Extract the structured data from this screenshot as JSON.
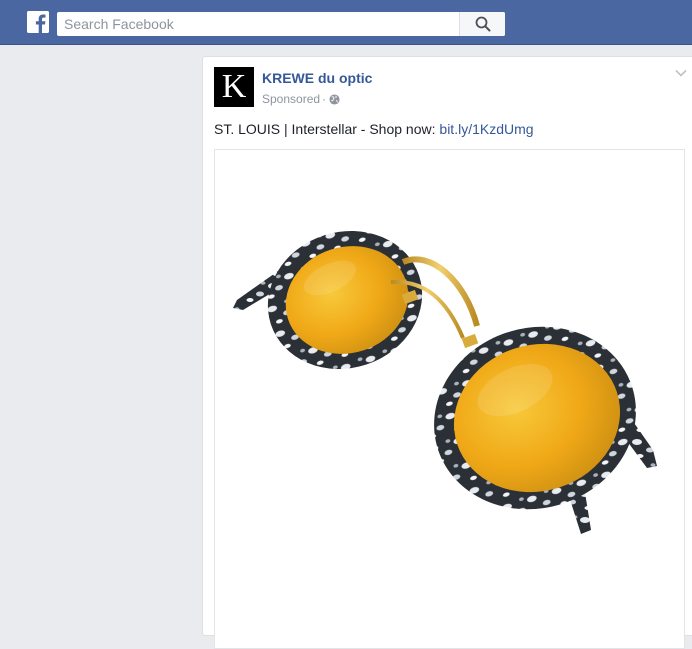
{
  "header": {
    "logo_icon": "facebook-f-icon",
    "search": {
      "placeholder": "Search Facebook",
      "value": "",
      "icon": "search-icon"
    },
    "brand_color": "#4b67a1"
  },
  "post": {
    "avatar_letter": "K",
    "page_name": "KREWE du optic",
    "sponsored_label": "Sponsored",
    "separator": "·",
    "privacy_icon": "globe-icon",
    "menu_icon": "chevron-down-icon",
    "text_prefix": "ST. LOUIS | Interstellar - Shop now: ",
    "link_text": "bit.ly/1KzdUmg",
    "image": {
      "subject": "sunglasses-image",
      "frame_color": "#2b2f36",
      "lens_color": "#f2b11c",
      "metal_color": "#d9ab3a"
    }
  }
}
